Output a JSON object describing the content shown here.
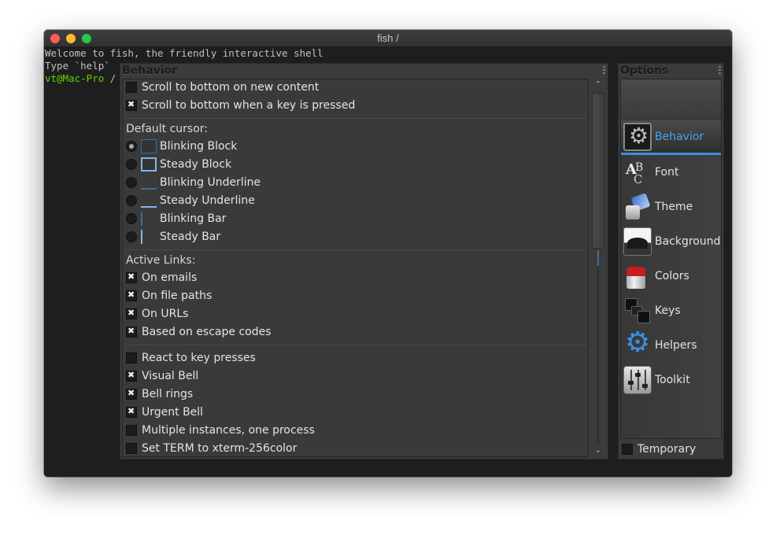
{
  "window": {
    "title": "fish /"
  },
  "terminal": {
    "line1": "Welcome to fish, the friendly interactive shell",
    "line2": "Type `help`",
    "prompt_user": "vt@Mac-Pro",
    "prompt_dir": " /"
  },
  "behavior": {
    "title": "Behavior",
    "scroll_new_content": {
      "label": "Scroll to bottom on new content",
      "checked": false
    },
    "scroll_key_pressed": {
      "label": "Scroll to bottom when a key is pressed",
      "checked": true
    },
    "cursor_heading": "Default cursor:",
    "cursors": [
      {
        "label": "Blinking Block",
        "selected": true
      },
      {
        "label": "Steady Block",
        "selected": false
      },
      {
        "label": "Blinking Underline",
        "selected": false
      },
      {
        "label": "Steady Underline",
        "selected": false
      },
      {
        "label": "Blinking Bar",
        "selected": false
      },
      {
        "label": "Steady Bar",
        "selected": false
      }
    ],
    "links_heading": "Active Links:",
    "links": [
      {
        "label": "On emails",
        "checked": true
      },
      {
        "label": "On file paths",
        "checked": true
      },
      {
        "label": "On URLs",
        "checked": true
      },
      {
        "label": "Based on escape codes",
        "checked": true
      }
    ],
    "misc": [
      {
        "label": "React to key presses",
        "checked": false
      },
      {
        "label": "Visual Bell",
        "checked": true
      },
      {
        "label": "Bell rings",
        "checked": true
      },
      {
        "label": "Urgent Bell",
        "checked": true
      },
      {
        "label": "Multiple instances, one process",
        "checked": false
      },
      {
        "label": "Set TERM to xterm-256color",
        "checked": false
      }
    ]
  },
  "options": {
    "title": "Options",
    "items": [
      {
        "label": "Behavior",
        "icon": "behavior-icon",
        "selected": true
      },
      {
        "label": "Font",
        "icon": "font-icon",
        "selected": false
      },
      {
        "label": "Theme",
        "icon": "theme-icon",
        "selected": false
      },
      {
        "label": "Background",
        "icon": "background-icon",
        "selected": false
      },
      {
        "label": "Colors",
        "icon": "colors-icon",
        "selected": false
      },
      {
        "label": "Keys",
        "icon": "keys-icon",
        "selected": false
      },
      {
        "label": "Helpers",
        "icon": "helpers-icon",
        "selected": false
      },
      {
        "label": "Toolkit",
        "icon": "toolkit-icon",
        "selected": false
      }
    ],
    "temporary": {
      "label": "Temporary",
      "checked": false
    }
  },
  "colors": {
    "accent": "#3a8ee6",
    "prompt": "#5fd700"
  }
}
